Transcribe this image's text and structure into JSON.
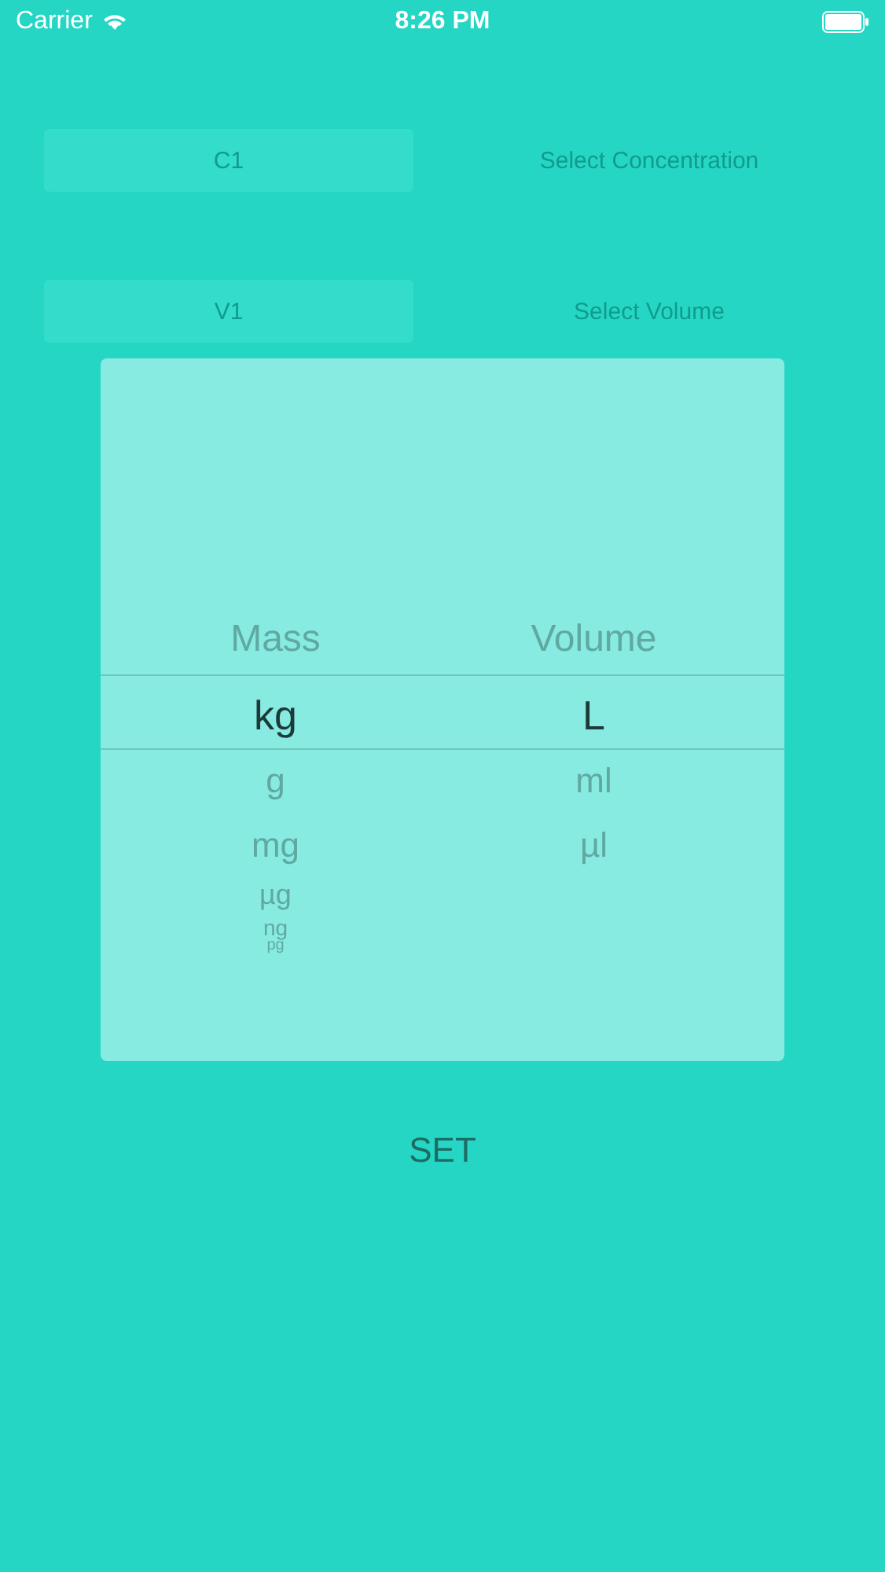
{
  "status_bar": {
    "carrier": "Carrier",
    "time": "8:26 PM"
  },
  "form_rows": [
    {
      "field_value": "C1",
      "button": "Select Concentration"
    },
    {
      "field_value": "V1",
      "button": "Select Volume"
    }
  ],
  "picker": {
    "columns": [
      {
        "title": "Mass",
        "items": [
          {
            "label": "kg",
            "selected": true
          },
          {
            "label": "g",
            "selected": false
          },
          {
            "label": "mg",
            "selected": false
          },
          {
            "label": "µg",
            "selected": false
          },
          {
            "label": "ng",
            "selected": false
          },
          {
            "label": "pg",
            "selected": false
          }
        ]
      },
      {
        "title": "Volume",
        "items": [
          {
            "label": "L",
            "selected": true
          },
          {
            "label": "ml",
            "selected": false
          },
          {
            "label": "µl",
            "selected": false
          }
        ]
      }
    ]
  },
  "set_button": "SET"
}
